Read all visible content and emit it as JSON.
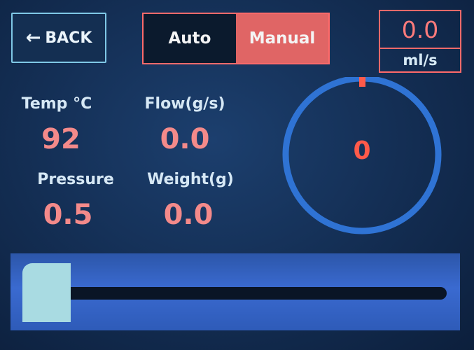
{
  "header": {
    "back_label": "BACK",
    "mode_auto": "Auto",
    "mode_manual": "Manual",
    "selected_mode": "Manual"
  },
  "flow_target": {
    "value": "0.0",
    "unit": "ml/s"
  },
  "metrics": {
    "temp": {
      "label": "Temp °C",
      "value": "92"
    },
    "flow": {
      "label": "Flow(g/s)",
      "value": "0.0"
    },
    "pressure": {
      "label": "Pressure",
      "value": "0.5"
    },
    "weight": {
      "label": "Weight(g)",
      "value": "0.0"
    }
  },
  "dial": {
    "value": "0",
    "level_fraction": 0.0
  },
  "slider": {
    "position_fraction": 0.0
  },
  "colors": {
    "accent_red": "#ff6a6a",
    "dial_blue": "#2f73d4",
    "value_pink": "#f48a8a",
    "knob": "#a9dbe2"
  },
  "icons": {
    "back": "arrow-left-icon"
  }
}
